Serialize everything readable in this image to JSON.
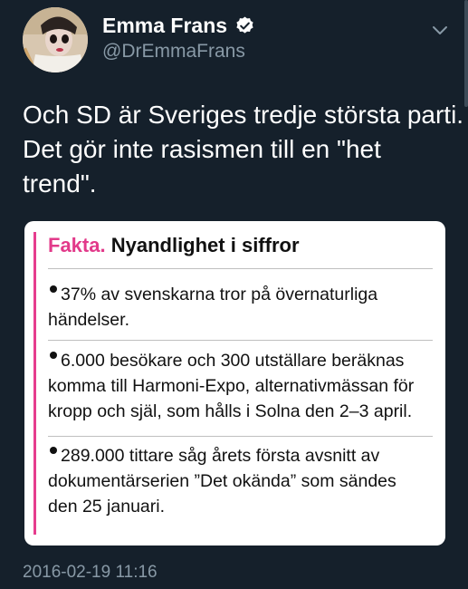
{
  "author": {
    "display_name": "Emma Frans",
    "handle": "@DrEmmaFrans",
    "verified": true
  },
  "tweet": {
    "text_lines": [
      "Och SD är Sveriges tredje största parti.",
      "Det gör inte rasismen till en \"het",
      "trend\"."
    ]
  },
  "card": {
    "label": "Fakta.",
    "title": "Nyandlighet i siffror",
    "items": [
      {
        "lines": [
          "37% av svenskarna tror på övernaturliga",
          "händelser."
        ]
      },
      {
        "lines": [
          "6.000 besökare och 300 utställare beräknas",
          "komma till Harmoni-Expo, alternativmässan för",
          "kropp och själ, som hålls i Solna den 2–3 april."
        ]
      },
      {
        "lines": [
          "289.000 tittare såg årets första avsnitt av",
          "dokumentärserien ”Det okända” som sändes",
          "den 25 januari."
        ]
      }
    ]
  },
  "timestamp": "2016-02-19 11:16",
  "colors": {
    "background": "#15202b",
    "accent_pink": "#e23a8a",
    "verified_blue": "#ffffff",
    "muted_text": "#8899a6"
  },
  "icons": {
    "verified": "verified-badge-icon",
    "caret": "chevron-down-icon"
  }
}
